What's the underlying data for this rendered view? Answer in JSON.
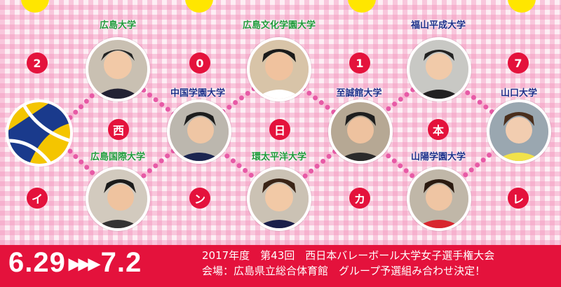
{
  "colors": {
    "badge": "#e4123c",
    "bar": "#e4123c",
    "label_green": "#1f9a3a",
    "label_navy": "#1d2f8a",
    "connector": "#e75aa6"
  },
  "badges": [
    "2",
    "0",
    "1",
    "7",
    "西",
    "日",
    "本",
    "イ",
    "ン",
    "カ",
    "レ"
  ],
  "universities": [
    "広島大学",
    "広島文化学園大学",
    "福山平成大学",
    "中国学園大学",
    "至誠館大学",
    "山口大学",
    "広島国際大学",
    "環太平洋大学",
    "山陽学園大学"
  ],
  "ball_icon": "volleyball-icon",
  "banner": {
    "date_start": "6.29",
    "arrows": "▶▶▶",
    "date_end": "7.2",
    "line1": "2017年度　第43回　西日本バレーボール大学女子選手権大会",
    "line2": "会場：広島県立総合体育館　グループ予選組み合わせ決定！"
  }
}
